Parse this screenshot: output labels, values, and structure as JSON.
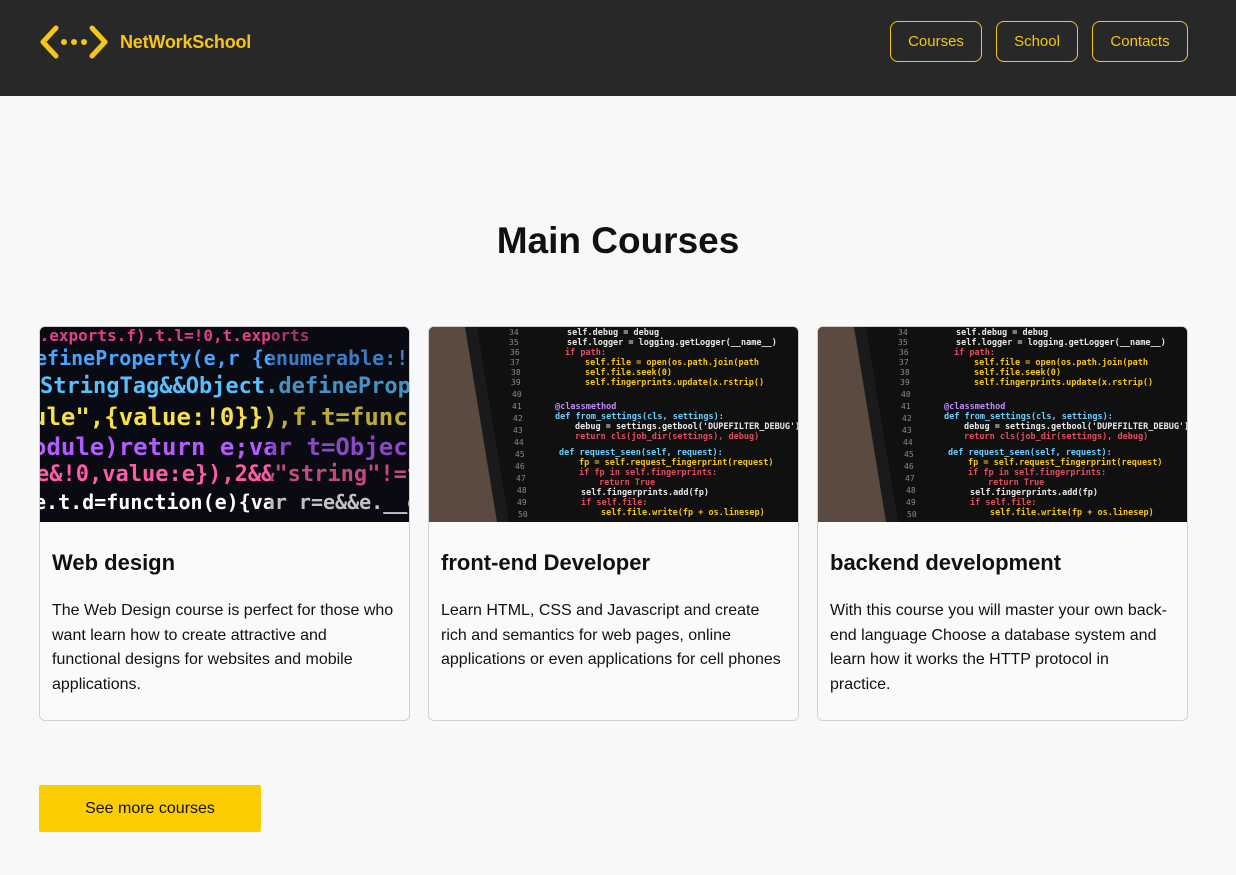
{
  "header": {
    "brand": "NetWorkSchool",
    "logo_icon": "code-brackets-icon",
    "brand_color": "#f5c518",
    "background": "#282828",
    "nav": [
      {
        "label": "Courses"
      },
      {
        "label": "School"
      },
      {
        "label": "Contacts"
      }
    ]
  },
  "main": {
    "title": "Main Courses",
    "courses": [
      {
        "title": "Web design",
        "description": "The Web Design course is perfect for those who want learn how to create attractive and functional designs for websites and mobile applications.",
        "image": "colorful-code-screen-photo"
      },
      {
        "title": "front-end Developer",
        "description": "Learn HTML, CSS and Javascript and create rich and semantics for web pages, online applications or even applications for cell phones",
        "image": "python-code-monitor-photo"
      },
      {
        "title": "backend development",
        "description": "With this course you will master your own back-end language Choose a database system and learn how it works the HTTP protocol in practice.",
        "image": "python-code-monitor-photo"
      }
    ],
    "more_button": "See more courses",
    "accent": "#fccd00"
  }
}
